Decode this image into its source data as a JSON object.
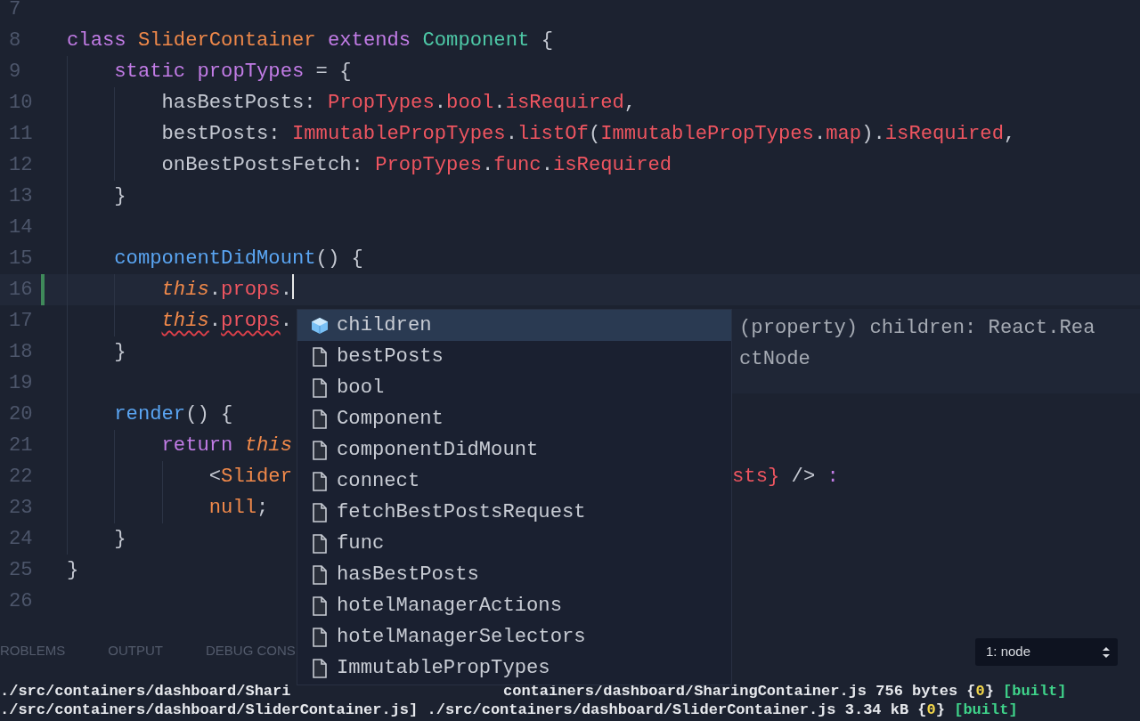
{
  "editor": {
    "lines": [
      {
        "number": "7",
        "cursor": false,
        "modified": false
      },
      {
        "number": "8",
        "cursor": false,
        "modified": false,
        "tokens": [
          {
            "kind": "kw",
            "text": "class"
          },
          {
            "kind": "cls",
            "text": " SliderContainer"
          },
          {
            "kind": "kw",
            "text": " extends"
          },
          {
            "kind": "type",
            "text": " Component"
          },
          {
            "kind": "punc",
            "text": " {"
          }
        ],
        "children": [
          {
            "number": "9",
            "cursor": false,
            "modified": false,
            "tokens": [
              {
                "kind": "kw",
                "text": "static propTypes"
              },
              {
                "kind": "punc",
                "text": " = {"
              }
            ],
            "children": [
              {
                "number": "10",
                "cursor": false,
                "modified": false,
                "tokens": [
                  {
                    "kind": "punc",
                    "text": "hasBestPosts: "
                  },
                  {
                    "kind": "red",
                    "text": "PropTypes"
                  },
                  {
                    "kind": "punc",
                    "text": "."
                  },
                  {
                    "kind": "red",
                    "text": "bool"
                  },
                  {
                    "kind": "punc",
                    "text": "."
                  },
                  {
                    "kind": "red",
                    "text": "isRequired"
                  },
                  {
                    "kind": "punc",
                    "text": ","
                  }
                ]
              },
              {
                "number": "11",
                "cursor": false,
                "modified": false,
                "tokens": [
                  {
                    "kind": "punc",
                    "text": "bestPosts: "
                  },
                  {
                    "kind": "red",
                    "text": "ImmutablePropTypes"
                  },
                  {
                    "kind": "punc",
                    "text": "."
                  },
                  {
                    "kind": "red",
                    "text": "listOf"
                  },
                  {
                    "kind": "punc",
                    "text": "("
                  },
                  {
                    "kind": "red",
                    "text": "ImmutablePropTypes"
                  },
                  {
                    "kind": "punc",
                    "text": "."
                  },
                  {
                    "kind": "red",
                    "text": "map"
                  },
                  {
                    "kind": "punc",
                    "text": ")."
                  },
                  {
                    "kind": "red",
                    "text": "isRequired"
                  },
                  {
                    "kind": "punc",
                    "text": ","
                  }
                ]
              },
              {
                "number": "12",
                "cursor": false,
                "modified": false,
                "tokens": [
                  {
                    "kind": "punc",
                    "text": "onBestPostsFetch: "
                  },
                  {
                    "kind": "red",
                    "text": "PropTypes"
                  },
                  {
                    "kind": "punc",
                    "text": "."
                  },
                  {
                    "kind": "red",
                    "text": "func"
                  },
                  {
                    "kind": "punc",
                    "text": "."
                  },
                  {
                    "kind": "red",
                    "text": "isRequired"
                  }
                ]
              }
            ]
          },
          {
            "number": "13",
            "cursor": false,
            "modified": false,
            "tokens": [
              {
                "kind": "punc",
                "text": "}"
              }
            ]
          },
          {
            "number": "14",
            "cursor": false,
            "modified": false
          },
          {
            "number": "15",
            "cursor": false,
            "modified": false,
            "tokens": [
              {
                "kind": "fn",
                "text": "componentDidMount"
              },
              {
                "kind": "punc",
                "text": "() {"
              }
            ],
            "children": [
              {
                "number": "16",
                "cursor": true,
                "modified": true,
                "tokens": [
                  {
                    "kind": "this",
                    "text": "this"
                  },
                  {
                    "kind": "punc",
                    "text": "."
                  },
                  {
                    "kind": "red",
                    "text": "props"
                  },
                  {
                    "kind": "punc",
                    "text": "."
                  }
                ]
              },
              {
                "number": "17",
                "cursor": false,
                "modified": false,
                "tokens": [
                  {
                    "kind": "this",
                    "text": "this",
                    "error": true
                  },
                  {
                    "kind": "punc",
                    "text": ".",
                    "error": false
                  },
                  {
                    "kind": "red",
                    "text": "props",
                    "error": true
                  },
                  {
                    "kind": "punc",
                    "text": ".",
                    "error": false
                  }
                ]
              }
            ]
          },
          {
            "number": "18",
            "cursor": false,
            "modified": false,
            "tokens": [
              {
                "kind": "punc",
                "text": "}"
              }
            ]
          },
          {
            "number": "19",
            "cursor": false,
            "modified": false
          },
          {
            "number": "20",
            "cursor": false,
            "modified": false,
            "tokens": [
              {
                "kind": "fn",
                "text": "render"
              },
              {
                "kind": "punc",
                "text": "() {"
              }
            ],
            "children": [
              {
                "number": "21",
                "cursor": false,
                "modified": false,
                "tokens": [
                  {
                    "kind": "kw",
                    "text": "return"
                  },
                  {
                    "kind": "this",
                    "text": " this"
                  }
                ],
                "children": [
                  {
                    "number": "22",
                    "cursor": false,
                    "modified": false,
                    "tokens": [
                      {
                        "kind": "punc",
                        "text": "<"
                      },
                      {
                        "kind": "cls",
                        "text": "Slider"
                      }
                    ],
                    "tokens_after": [
                      {
                        "kind": "red",
                        "text": "sts}"
                      },
                      {
                        "kind": "punc",
                        "text": " />"
                      },
                      {
                        "kind": "kw",
                        "text": " :"
                      }
                    ]
                  },
                  {
                    "number": "23",
                    "cursor": false,
                    "modified": false,
                    "tokens": [
                      {
                        "kind": "cls",
                        "text": "null"
                      },
                      {
                        "kind": "punc",
                        "text": ";"
                      }
                    ]
                  }
                ]
              }
            ]
          },
          {
            "number": "24",
            "cursor": false,
            "modified": false,
            "tokens": [
              {
                "kind": "punc",
                "text": "}"
              }
            ]
          }
        ]
      },
      {
        "number": "25",
        "cursor": false,
        "modified": false,
        "tokens": [
          {
            "kind": "punc",
            "text": "}"
          }
        ]
      },
      {
        "number": "26",
        "cursor": false,
        "modified": false
      }
    ]
  },
  "suggestions": {
    "items": [
      {
        "kind": "property",
        "label": "children",
        "selected": true
      },
      {
        "kind": "file",
        "label": "bestPosts",
        "selected": false
      },
      {
        "kind": "file",
        "label": "bool",
        "selected": false
      },
      {
        "kind": "file",
        "label": "Component",
        "selected": false
      },
      {
        "kind": "file",
        "label": "componentDidMount",
        "selected": false
      },
      {
        "kind": "file",
        "label": "connect",
        "selected": false
      },
      {
        "kind": "file",
        "label": "fetchBestPostsRequest",
        "selected": false
      },
      {
        "kind": "file",
        "label": "func",
        "selected": false
      },
      {
        "kind": "file",
        "label": "hasBestPosts",
        "selected": false
      },
      {
        "kind": "file",
        "label": "hotelManagerActions",
        "selected": false
      },
      {
        "kind": "file",
        "label": "hotelManagerSelectors",
        "selected": false
      },
      {
        "kind": "file",
        "label": "ImmutablePropTypes",
        "selected": false
      }
    ],
    "details": [
      "(property) children: React.Rea",
      "ctNode"
    ]
  },
  "panel": {
    "tabs": [
      {
        "label": "ROBLEMS",
        "selected": false
      },
      {
        "label": "OUTPUT",
        "selected": false
      },
      {
        "label": "DEBUG CONS",
        "selected": false
      }
    ],
    "terminal_select": "1: node",
    "terminal_lines": [
      {
        "tokens": [
          {
            "kind": "path",
            "text": "./src/containers/dashboard/Shari"
          }
        ],
        "tokens_after": [
          {
            "kind": "path",
            "text": "containers/dashboard/SharingContainer.js 756 bytes {"
          },
          {
            "kind": "num",
            "text": "0"
          },
          {
            "kind": "path",
            "text": "}"
          },
          {
            "kind": "ok",
            "text": " [built]"
          }
        ]
      },
      {
        "tokens": [
          {
            "kind": "path",
            "text": "./src/containers/dashboard/SliderContainer.js] ./src/containers/dashboard/SliderContainer.js 3.34 kB {"
          },
          {
            "kind": "num",
            "text": "0"
          },
          {
            "kind": "path",
            "text": "}"
          },
          {
            "kind": "ok",
            "text": " [built]"
          }
        ]
      }
    ]
  }
}
